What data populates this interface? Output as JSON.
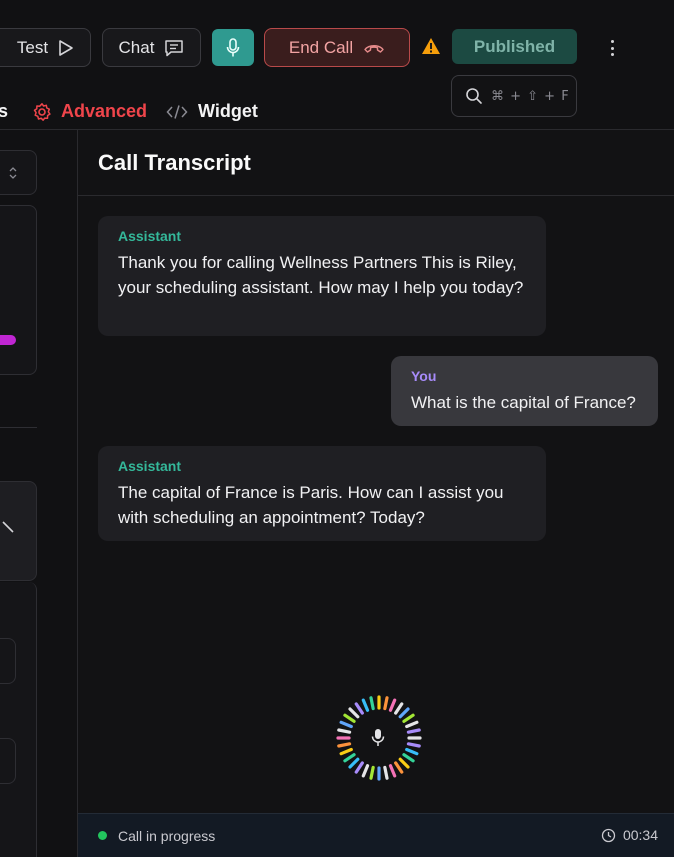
{
  "toolbar": {
    "test_label": "Test",
    "chat_label": "Chat",
    "end_call_label": "End Call",
    "published_label": "Published",
    "search_shortcut": "⌘ + ⇧ + F"
  },
  "tabs": {
    "partial_label": "s",
    "advanced_label": "Advanced",
    "widget_label": "Widget"
  },
  "transcript": {
    "title": "Call Transcript",
    "messages": [
      {
        "speaker": "Assistant",
        "text": "Thank you for calling Wellness Partners This is Riley, your scheduling assistant. How may I help you today?"
      },
      {
        "speaker": "You",
        "text": "What is the capital of France?"
      },
      {
        "speaker": "Assistant",
        "text": "The capital of France is Paris. How can I assist you with scheduling an appointment? Today?"
      }
    ]
  },
  "status": {
    "text": "Call in progress",
    "timer": "00:34"
  },
  "colors": {
    "accent_teal": "#2f9a90",
    "end_call_red": "#b94a4a",
    "advanced_red": "#f0454b",
    "assistant_green": "#34b89a",
    "you_purple": "#a78bfa",
    "status_green": "#22c55e"
  }
}
